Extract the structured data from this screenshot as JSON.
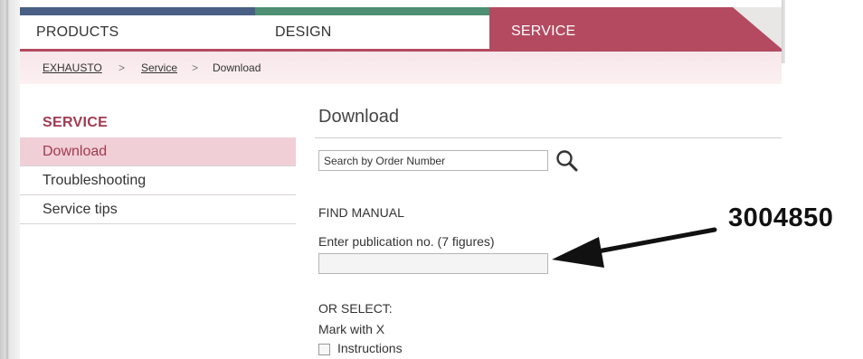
{
  "tabs": [
    {
      "label": "PRODUCTS",
      "color": "#4a5f84"
    },
    {
      "label": "DESIGN",
      "color": "#4e8e72"
    },
    {
      "label": "SERVICE",
      "color": "#b34a60"
    }
  ],
  "breadcrumb": {
    "items": [
      "EXHAUSTO",
      "Service",
      "Download"
    ],
    "separator": ">"
  },
  "sidebar": {
    "title": "SERVICE",
    "items": [
      {
        "label": "Download",
        "active": true
      },
      {
        "label": "Troubleshooting",
        "active": false
      },
      {
        "label": "Service tips",
        "active": false
      }
    ]
  },
  "main": {
    "title": "Download",
    "search": {
      "value": "Search by Order Number"
    },
    "find_manual": "FIND MANUAL",
    "publication_label": "Enter publication no. (7 figures)",
    "publication_value": "",
    "or_select": "OR SELECT:",
    "mark_hint": "Mark with X",
    "checkbox_label": "Instructions"
  },
  "annotation": {
    "number": "3004850",
    "icon": "arrow-left-icon"
  },
  "colors": {
    "accent": "#b34a60",
    "sidebar_title": "#a23a52",
    "active_bg": "#f0cfd6"
  }
}
